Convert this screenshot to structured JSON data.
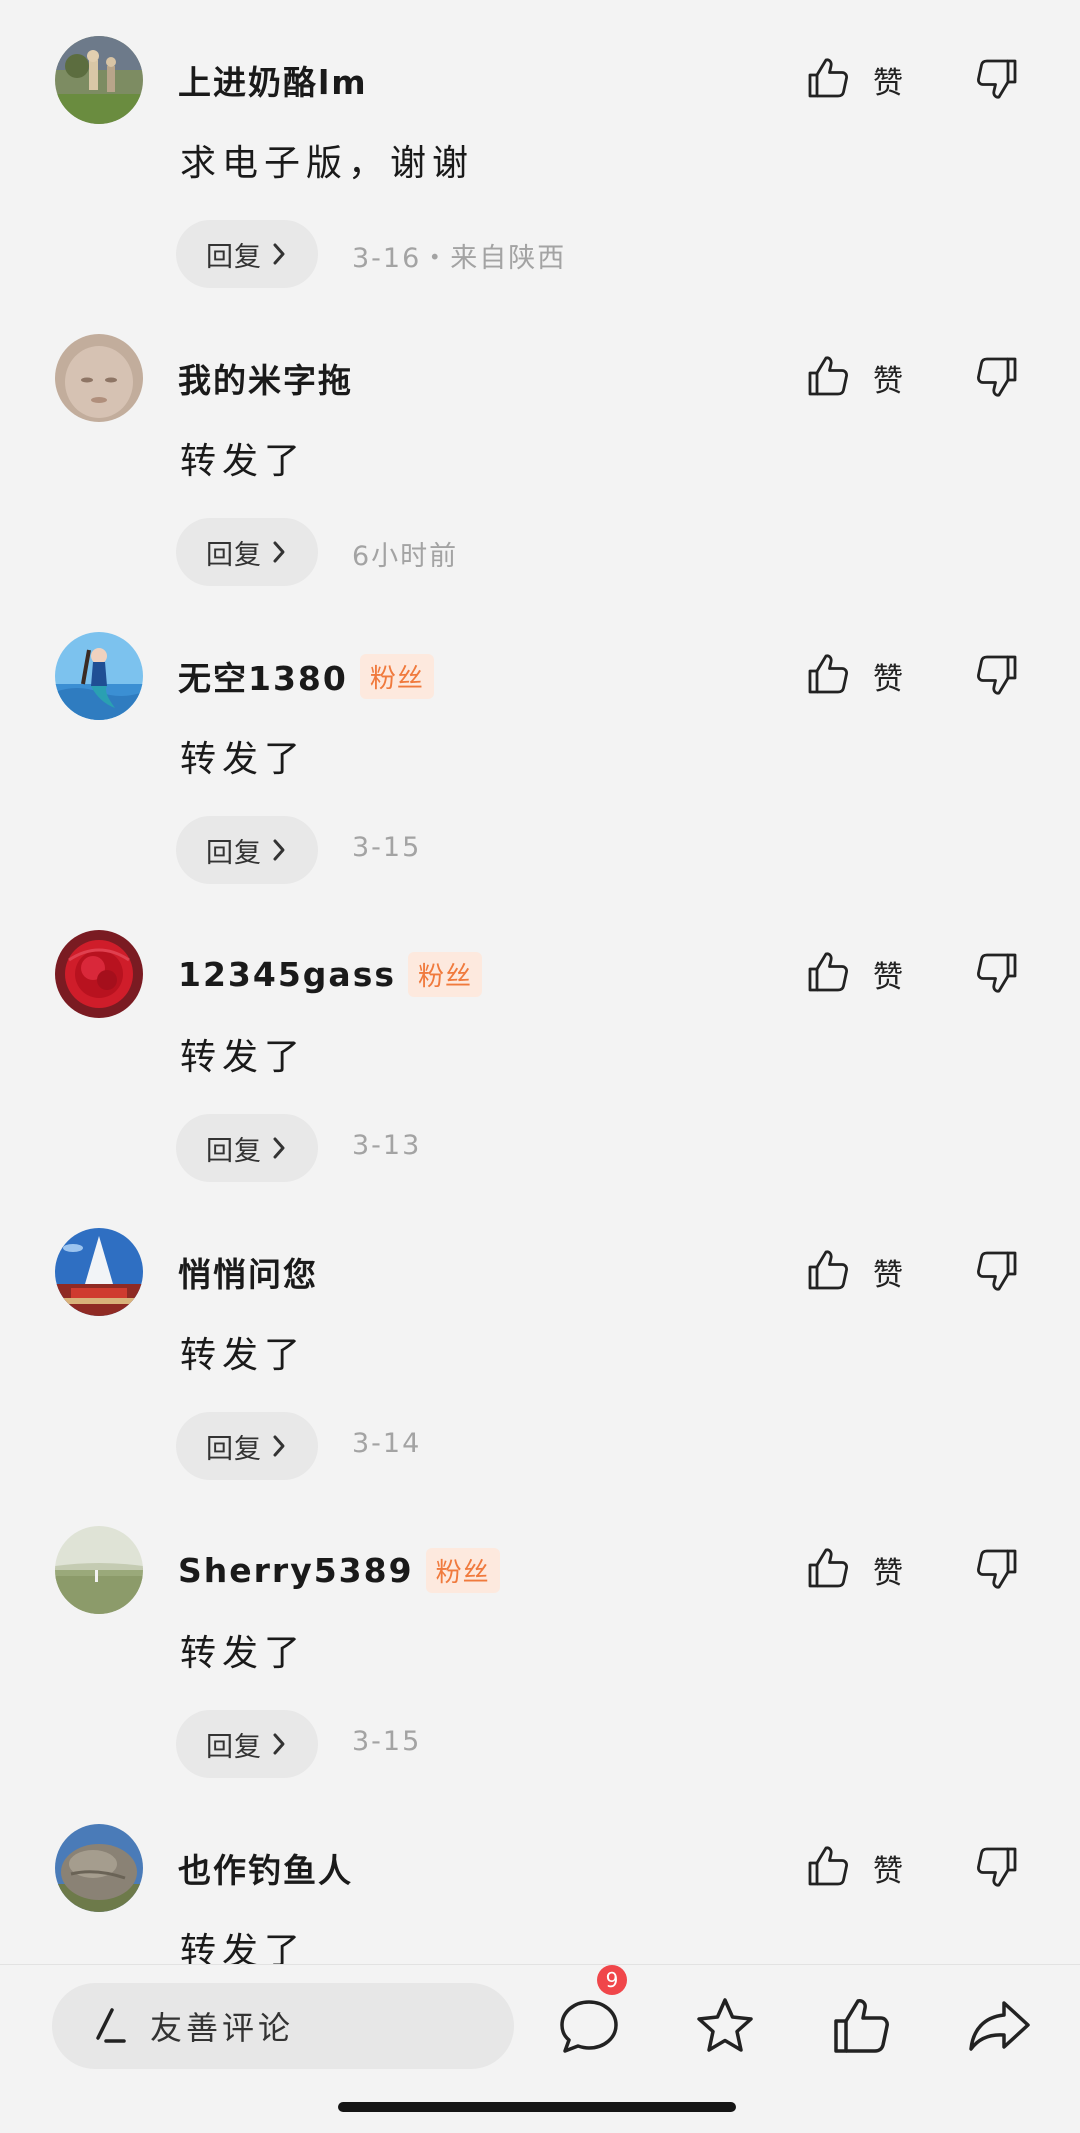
{
  "comments": [
    {
      "username": "上进奶酪lm",
      "badge": "",
      "text": "求电子版，谢谢",
      "meta": "3-16・来自陕西",
      "avatar": "people-outdoors"
    },
    {
      "username": "我的米字拖",
      "badge": "",
      "text": "转发了",
      "meta": "6小时前",
      "avatar": "face-closeup"
    },
    {
      "username": "无空1380",
      "badge": "粉丝",
      "text": "转发了",
      "meta": "3-15",
      "avatar": "mermaid-sea"
    },
    {
      "username": "12345gass",
      "badge": "粉丝",
      "text": "转发了",
      "meta": "3-13",
      "avatar": "red-flower"
    },
    {
      "username": "悄悄问您",
      "badge": "",
      "text": "转发了",
      "meta": "3-14",
      "avatar": "monument-sky"
    },
    {
      "username": "Sherry5389",
      "badge": "粉丝",
      "text": "转发了",
      "meta": "3-15",
      "avatar": "field-landscape"
    },
    {
      "username": "也作钓鱼人",
      "badge": "",
      "text": "转发了",
      "meta": "",
      "avatar": "rock-stone"
    }
  ],
  "like_label": "赞",
  "reply_label": "回复",
  "compose_placeholder": "友善评论",
  "message_count": "9",
  "colors": {
    "fan_badge_text": "#f07a3d",
    "fan_badge_bg": "#fde9de",
    "badge_red": "#f0464a"
  }
}
